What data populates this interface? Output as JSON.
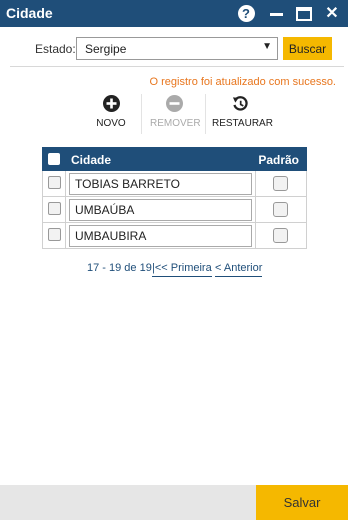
{
  "window": {
    "title": "Cidade",
    "help_glyph": "?",
    "close_glyph": "✕"
  },
  "filter": {
    "estado_label": "Estado:",
    "estado_value": "Sergipe",
    "dropdown_arrow": "▼",
    "buscar_label": "Buscar"
  },
  "message": "O registro foi atualizado com sucesso.",
  "toolbar": {
    "novo_label": "NOVO",
    "remover_label": "REMOVER",
    "restaurar_label": "RESTAURAR"
  },
  "grid": {
    "col_cidade": "Cidade",
    "col_padrao": "Padrão",
    "rows": [
      {
        "cidade": "TOBIAS BARRETO"
      },
      {
        "cidade": "UMBAÚBA"
      },
      {
        "cidade": "UMBAUBIRA"
      }
    ]
  },
  "pager": {
    "info": "17 - 19 de 19",
    "first_label": "|<< Primeira",
    "prev_label": "< Anterior"
  },
  "footer": {
    "salvar_label": "Salvar"
  },
  "colors": {
    "header_blue": "#1f4e79",
    "accent_yellow": "#f5b800",
    "message_orange": "#e8761e"
  },
  "icons": {
    "novo": "plus-circle-icon",
    "remover": "minus-circle-icon",
    "restaurar": "restore-icon"
  }
}
